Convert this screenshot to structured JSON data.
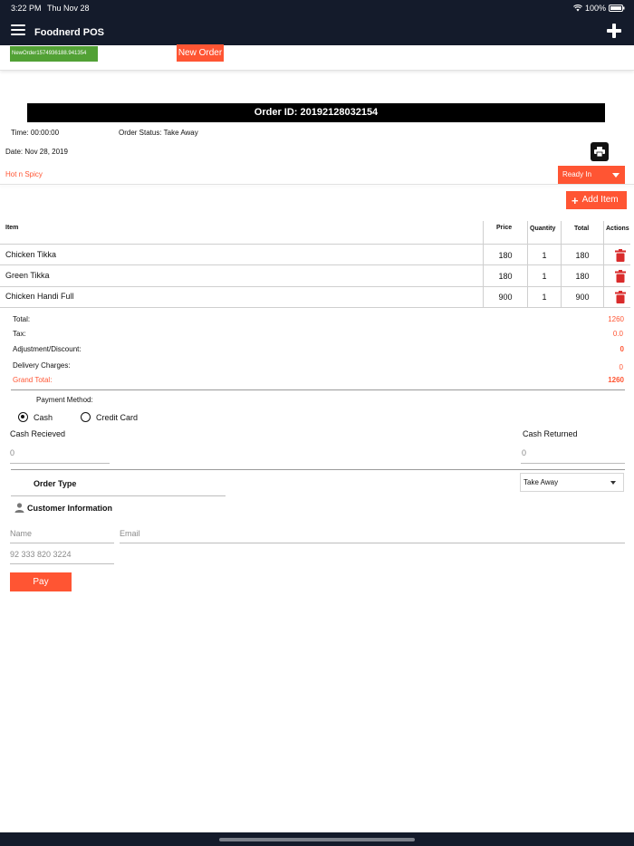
{
  "status_bar": {
    "time": "3:22 PM",
    "date": "Thu Nov 28",
    "battery": "100%"
  },
  "app": {
    "title": "Foodnerd POS"
  },
  "tabs": {
    "active_order": "NewOrder1574936188.941354",
    "new_order_label": "New Order"
  },
  "order": {
    "id_label": "Order ID: 20192128032154",
    "time": "Time: 00:00:00",
    "status": "Order Status: Take Away",
    "date": "Date: Nov 28, 2019",
    "restaurant": "Hot n Spicy",
    "ready_status": "Ready In",
    "add_item_label": "Add Item"
  },
  "table": {
    "headers": {
      "item": "Item",
      "price": "Price",
      "quantity": "Quantity",
      "total": "Total",
      "actions": "Actions"
    },
    "rows": [
      {
        "item": "Chicken Tikka",
        "price": "180",
        "quantity": "1",
        "total": "180"
      },
      {
        "item": "Green Tikka",
        "price": "180",
        "quantity": "1",
        "total": "180"
      },
      {
        "item": "Chicken Handi Full",
        "price": "900",
        "quantity": "1",
        "total": "900"
      }
    ]
  },
  "totals": {
    "total_label": "Total:",
    "total_value": "1260",
    "tax_label": "Tax:",
    "tax_value": "0.0",
    "adjust_label": "Adjustment/Discount:",
    "adjust_value": "0",
    "delivery_label": "Delivery Charges:",
    "delivery_value": "0",
    "grand_label": "Grand Total:",
    "grand_value": "1260"
  },
  "payment": {
    "method_label": "Payment Method:",
    "cash_label": "Cash",
    "card_label": "Credit Card",
    "selected": "Cash",
    "cash_received_label": "Cash Recieved",
    "cash_received_value": "0",
    "cash_returned_label": "Cash Returned",
    "cash_returned_value": "0",
    "order_type_label": "Order Type",
    "order_type_value": "Take Away"
  },
  "customer": {
    "heading": "Customer Information",
    "name_placeholder": "Name",
    "email_placeholder": "Email",
    "phone_value": "92 333 820 3224"
  },
  "pay_label": "Pay",
  "colors": {
    "accent": "#ff5533",
    "nav": "#141b2b",
    "tab_green": "#52a135"
  }
}
